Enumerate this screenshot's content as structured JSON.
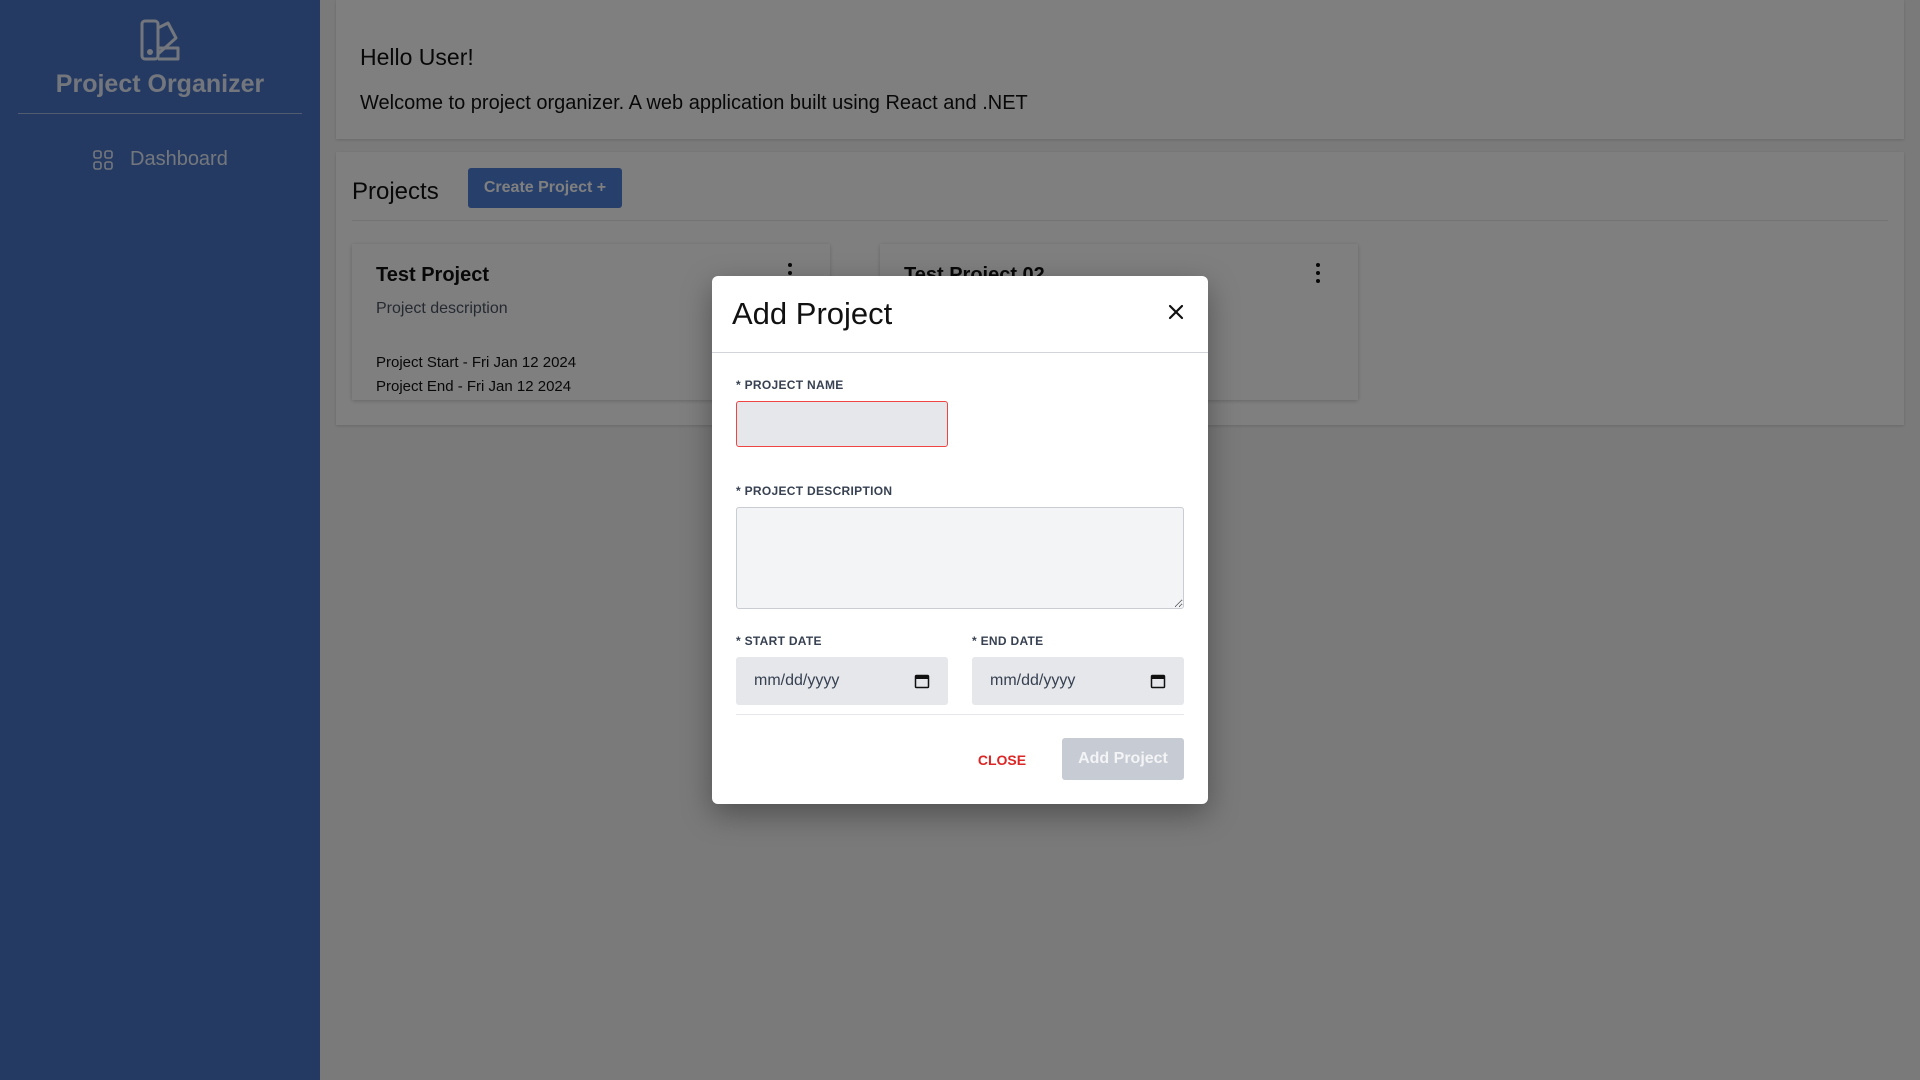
{
  "sidebar": {
    "brand_icon": "palette-swatch-icon",
    "brand_title": "Project Organizer",
    "nav_items": [
      {
        "icon": "grid-icon",
        "label": "Dashboard"
      }
    ]
  },
  "header": {
    "greeting": "Hello User!",
    "welcome": "Welcome to project organizer. A web application built using React and .NET"
  },
  "projects": {
    "title": "Projects",
    "create_label": "Create Project +",
    "cards": [
      {
        "title": "Test Project",
        "description": "Project description",
        "start": "Project Start - Fri Jan 12 2024",
        "end": "Project End - Fri Jan 12 2024"
      },
      {
        "title": "Test Project 02",
        "description": "",
        "start": "",
        "end": ""
      }
    ]
  },
  "modal": {
    "title": "Add Project",
    "name_label": "* PROJECT NAME",
    "name_value": "",
    "description_label": "* PROJECT DESCRIPTION",
    "description_value": "",
    "start_label": "* START DATE",
    "start_placeholder": "mm/dd/yyyy",
    "end_label": "* END DATE",
    "end_placeholder": "mm/dd/yyyy",
    "close_label": "CLOSE",
    "submit_label": "Add Project"
  },
  "colors": {
    "sidebar": "#4874c5",
    "primary_button": "#4f7fd6",
    "error_border": "#ef4444",
    "close_text": "#dc2626",
    "disabled_button": "#c7cbd3"
  }
}
